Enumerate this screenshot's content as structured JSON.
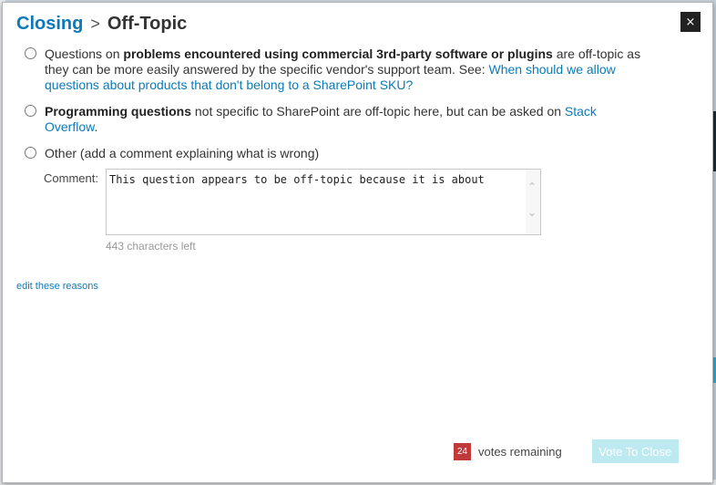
{
  "dialog": {
    "breadcrumb": {
      "parent": "Closing",
      "separator": ">",
      "current": "Off-Topic"
    },
    "close_label": "×",
    "options": [
      {
        "pre": "Questions on ",
        "bold": "problems encountered using commercial 3rd-party software or plugins",
        "post": " are off-topic as they can be more easily answered by the specific vendor's support team. See: ",
        "link": "When should we allow questions about products that don't belong to a SharePoint SKU?",
        "tail": ""
      },
      {
        "pre": "",
        "bold": "Programming questions",
        "post": " not specific to SharePoint are off-topic here, but can be asked on ",
        "link": "Stack Overflow",
        "tail": "."
      },
      {
        "pre": "Other (add a comment explaining what is wrong)",
        "bold": "",
        "post": "",
        "link": "",
        "tail": ""
      }
    ],
    "comment": {
      "label": "Comment:",
      "value": "This question appears to be off-topic because it is about",
      "chars_left": "443 characters left"
    },
    "edit_reasons_link": "edit these reasons",
    "footer": {
      "votes_count": "24",
      "votes_label": "votes remaining",
      "vote_button": "Vote To Close"
    }
  },
  "icons": {
    "close": "close-icon",
    "scroll_up": "chevron-up-icon",
    "scroll_down": "chevron-down-icon"
  },
  "colors": {
    "link": "#0c7ab8",
    "badge": "#c0393b",
    "vote_button_disabled": "#bde9f1",
    "close_button": "#222222"
  }
}
